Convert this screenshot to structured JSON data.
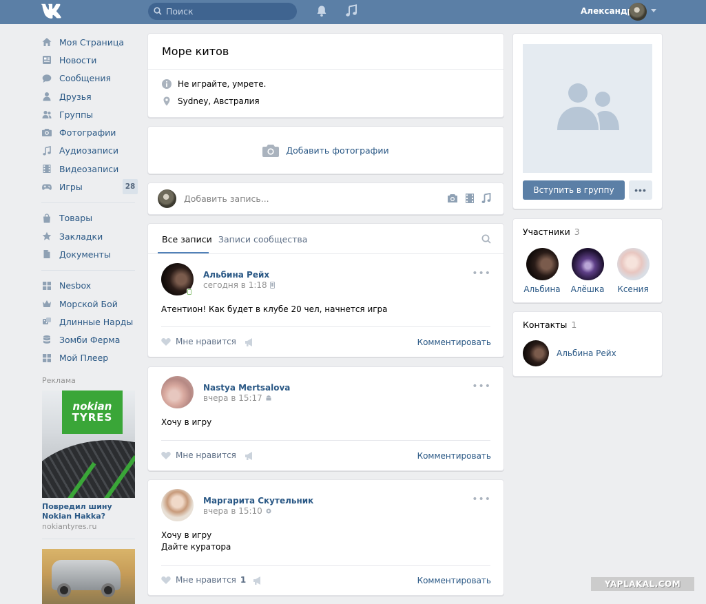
{
  "header": {
    "logo_icon": "vk-logo-icon",
    "search_placeholder": "Поиск",
    "user_name": "Александр"
  },
  "nav": {
    "items": [
      {
        "label": "Моя Страница",
        "icon": "home-icon"
      },
      {
        "label": "Новости",
        "icon": "news-icon"
      },
      {
        "label": "Сообщения",
        "icon": "messages-icon"
      },
      {
        "label": "Друзья",
        "icon": "friends-icon"
      },
      {
        "label": "Группы",
        "icon": "groups-icon"
      },
      {
        "label": "Фотографии",
        "icon": "camera-icon"
      },
      {
        "label": "Аудиозаписи",
        "icon": "music-icon"
      },
      {
        "label": "Видеозаписи",
        "icon": "video-icon"
      },
      {
        "label": "Игры",
        "icon": "gamepad-icon",
        "badge": "28"
      }
    ],
    "items2": [
      {
        "label": "Товары",
        "icon": "bag-icon"
      },
      {
        "label": "Закладки",
        "icon": "star-icon"
      },
      {
        "label": "Документы",
        "icon": "document-icon"
      }
    ],
    "apps": [
      {
        "label": "Nesbox",
        "icon": "app-grid-icon"
      },
      {
        "label": "Морской Бой",
        "icon": "crown-icon"
      },
      {
        "label": "Длинные Нарды",
        "icon": "dice-icon"
      },
      {
        "label": "Зомби Ферма",
        "icon": "database-icon"
      },
      {
        "label": "Мой Плеер",
        "icon": "app-grid-icon"
      }
    ]
  },
  "ads": {
    "label": "Реклама",
    "logo_line1": "nokian",
    "logo_line2": "TYRES",
    "title": "Повредил шину Nokian Hakka?",
    "domain": "nokiantyres.ru"
  },
  "group": {
    "name": "Море китов",
    "status": "Не играйте, умрете.",
    "location": "Sydney, Австралия",
    "add_photos": "Добавить фотографии",
    "composer_placeholder": "Добавить запись..."
  },
  "tabs": {
    "all": "Все записи",
    "community": "Записи сообщества"
  },
  "posts": [
    {
      "author": "Альбина Рейх",
      "time": "сегодня в 1:18",
      "text": "Атентион! Как будет в клубе 20 чел, начнется игра",
      "like_label": "Мне нравится",
      "comment_label": "Комментировать"
    },
    {
      "author": "Nastya Mertsalova",
      "time": "вчера в 15:17",
      "text": "Хочу в игру",
      "like_label": "Мне нравится",
      "comment_label": "Комментировать"
    },
    {
      "author": "Маргарита Скутельник",
      "time": "вчера в 15:10",
      "text1": "Хочу в игру",
      "text2": "Дайте куратора",
      "like_label": "Мне нравится",
      "like_count": "1",
      "comment_label": "Комментировать"
    }
  ],
  "sidebar_right": {
    "join_label": "Вступить в группу",
    "members_title": "Участники",
    "members_count": "3",
    "members": [
      "Альбина",
      "Алёшка",
      "Ксения"
    ],
    "contacts_title": "Контакты",
    "contacts_count": "1",
    "contact_name": "Альбина Рейх"
  },
  "watermark": "YAPLAKAL.COM",
  "colors": {
    "header": "#5b7fa6",
    "link": "#2a5885",
    "background": "#edeef0"
  }
}
